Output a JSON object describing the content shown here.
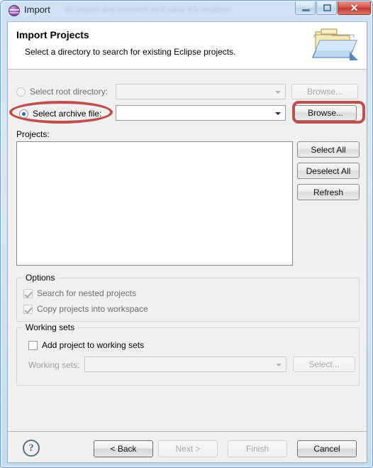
{
  "window": {
    "title": "Import",
    "icon": "eclipse-sphere-icon",
    "ghost_text": "to import any element and save it's location",
    "controls": {
      "minimize": "minimize-button",
      "maximize": "maximize-button",
      "close": "✕"
    }
  },
  "header": {
    "title": "Import Projects",
    "description": "Select a directory to search for existing Eclipse projects.",
    "icon": "import-folder-icon"
  },
  "source": {
    "root_directory": {
      "label": "Select root directory:",
      "selected": false,
      "enabled": false,
      "combo_value": "",
      "browse_label": "Browse...",
      "browse_enabled": false
    },
    "archive_file": {
      "label": "Select archive file:",
      "selected": true,
      "enabled": true,
      "combo_value": "",
      "browse_label": "Browse...",
      "browse_enabled": true,
      "highlighted": true
    }
  },
  "projects": {
    "label": "Projects:",
    "items": [],
    "buttons": [
      {
        "label": "Select All",
        "enabled": true
      },
      {
        "label": "Deselect All",
        "enabled": true
      },
      {
        "label": "Refresh",
        "enabled": true
      }
    ]
  },
  "options": {
    "title": "Options",
    "checkboxes": [
      {
        "label": "Search for nested projects",
        "checked": true,
        "enabled": false
      },
      {
        "label": "Copy projects into workspace",
        "checked": true,
        "enabled": false
      }
    ]
  },
  "working_sets": {
    "title": "Working sets",
    "add_checkbox": {
      "label": "Add project to working sets",
      "checked": false,
      "enabled": true
    },
    "combo_label": "Working sets:",
    "combo_value": "",
    "combo_enabled": false,
    "select_label": "Select...",
    "select_enabled": false
  },
  "footer": {
    "help": "?",
    "buttons": [
      {
        "label": "< Back",
        "enabled": true,
        "default": true
      },
      {
        "label": "Next >",
        "enabled": false,
        "default": false
      },
      {
        "label": "Finish",
        "enabled": false,
        "default": false
      },
      {
        "label": "Cancel",
        "enabled": true,
        "default": true
      }
    ]
  },
  "colors": {
    "annotation": "#bf4f4f",
    "radio_accent": "#2c6ca8",
    "titlebar": "#cfe2f3"
  }
}
